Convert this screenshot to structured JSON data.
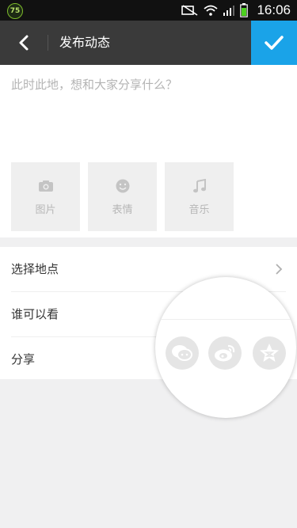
{
  "status_bar": {
    "battery_badge": "75",
    "time": "16:06"
  },
  "title_bar": {
    "title": "发布动态",
    "back_icon": "back-arrow-icon",
    "confirm_icon": "checkmark-icon"
  },
  "composer": {
    "placeholder": "此时此地，想和大家分享什么？",
    "tiles": [
      {
        "label": "图片",
        "icon": "camera-icon"
      },
      {
        "label": "表情",
        "icon": "emoji-icon"
      },
      {
        "label": "音乐",
        "icon": "music-note-icon"
      }
    ]
  },
  "options": [
    {
      "label": "选择地点"
    },
    {
      "label": "谁可以看"
    },
    {
      "label": "分享"
    }
  ],
  "share_icons": [
    "wechat-moments-icon",
    "weibo-icon",
    "qzone-icon"
  ],
  "colors": {
    "accent": "#1aa3e8",
    "titlebar": "#3a3a3a",
    "statusbar": "#111111"
  }
}
